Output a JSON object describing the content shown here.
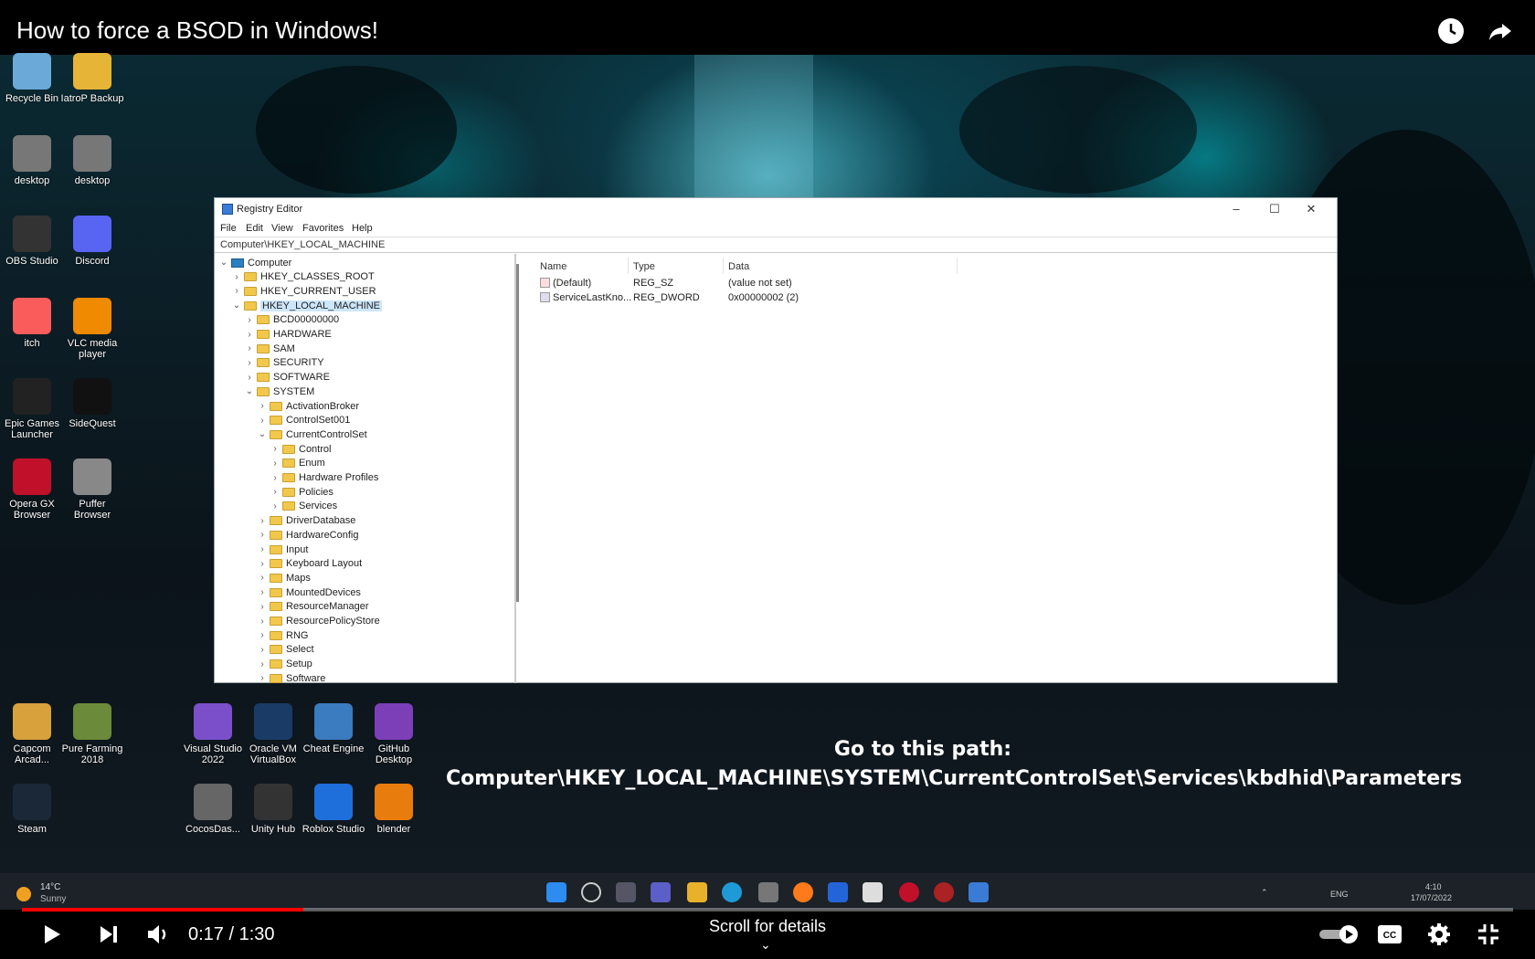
{
  "player": {
    "title": "How to force a BSOD in Windows!",
    "time": "0:17 / 1:30",
    "progress": 0.189,
    "scroll_hint": "Scroll for details",
    "autoplay_on": true
  },
  "desktop_icons": [
    {
      "label": "Recycle Bin",
      "icon": "recycle-bin-icon"
    },
    {
      "label": "IatroP Backup",
      "icon": "folder-icon"
    },
    {
      "label": "desktop",
      "icon": "shortcut-icon"
    },
    {
      "label": "desktop",
      "icon": "shortcut-icon"
    },
    {
      "label": "OBS Studio",
      "icon": "obs-icon"
    },
    {
      "label": "Discord",
      "icon": "discord-icon"
    },
    {
      "label": "itch",
      "icon": "itch-icon"
    },
    {
      "label": "VLC media player",
      "icon": "vlc-icon"
    },
    {
      "label": "Epic Games Launcher",
      "icon": "epic-icon"
    },
    {
      "label": "SideQuest",
      "icon": "sidequest-icon"
    },
    {
      "label": "Opera GX Browser",
      "icon": "opera-icon"
    },
    {
      "label": "Puffer Browser",
      "icon": "puffer-icon"
    },
    {
      "label": "Capcom Arcad...",
      "icon": "capcom-icon"
    },
    {
      "label": "Pure Farming 2018",
      "icon": "pure-farming-icon"
    },
    {
      "label": "Visual Studio 2022",
      "icon": "visual-studio-icon"
    },
    {
      "label": "Oracle VM VirtualBox",
      "icon": "virtualbox-icon"
    },
    {
      "label": "Cheat Engine",
      "icon": "cheat-engine-icon"
    },
    {
      "label": "GitHub Desktop",
      "icon": "github-icon"
    },
    {
      "label": "Steam",
      "icon": "steam-icon"
    },
    {
      "label": "CocosDas...",
      "icon": "cocos-icon"
    },
    {
      "label": "Unity Hub",
      "icon": "unity-icon"
    },
    {
      "label": "Roblox Studio",
      "icon": "roblox-icon"
    },
    {
      "label": "blender",
      "icon": "blender-icon"
    }
  ],
  "regedit": {
    "title": "Registry Editor",
    "menu": [
      "File",
      "Edit",
      "View",
      "Favorites",
      "Help"
    ],
    "address": "Computer\\HKEY_LOCAL_MACHINE",
    "tree": [
      {
        "label": "Computer",
        "depth": 0,
        "expanded": true,
        "root": true
      },
      {
        "label": "HKEY_CLASSES_ROOT",
        "depth": 1
      },
      {
        "label": "HKEY_CURRENT_USER",
        "depth": 1
      },
      {
        "label": "HKEY_LOCAL_MACHINE",
        "depth": 1,
        "expanded": true,
        "selected": true
      },
      {
        "label": "BCD00000000",
        "depth": 2
      },
      {
        "label": "HARDWARE",
        "depth": 2
      },
      {
        "label": "SAM",
        "depth": 2
      },
      {
        "label": "SECURITY",
        "depth": 2
      },
      {
        "label": "SOFTWARE",
        "depth": 2
      },
      {
        "label": "SYSTEM",
        "depth": 2,
        "expanded": true
      },
      {
        "label": "ActivationBroker",
        "depth": 3
      },
      {
        "label": "ControlSet001",
        "depth": 3
      },
      {
        "label": "CurrentControlSet",
        "depth": 3,
        "expanded": true
      },
      {
        "label": "Control",
        "depth": 4
      },
      {
        "label": "Enum",
        "depth": 4
      },
      {
        "label": "Hardware Profiles",
        "depth": 4
      },
      {
        "label": "Policies",
        "depth": 4
      },
      {
        "label": "Services",
        "depth": 4
      },
      {
        "label": "DriverDatabase",
        "depth": 3
      },
      {
        "label": "HardwareConfig",
        "depth": 3
      },
      {
        "label": "Input",
        "depth": 3
      },
      {
        "label": "Keyboard Layout",
        "depth": 3
      },
      {
        "label": "Maps",
        "depth": 3
      },
      {
        "label": "MountedDevices",
        "depth": 3
      },
      {
        "label": "ResourceManager",
        "depth": 3
      },
      {
        "label": "ResourcePolicyStore",
        "depth": 3
      },
      {
        "label": "RNG",
        "depth": 3
      },
      {
        "label": "Select",
        "depth": 3
      },
      {
        "label": "Setup",
        "depth": 3
      },
      {
        "label": "Software",
        "depth": 3
      }
    ],
    "columns": [
      "Name",
      "Type",
      "Data"
    ],
    "values": [
      {
        "name": "(Default)",
        "type": "REG_SZ",
        "data": "(value not set)"
      },
      {
        "name": "ServiceLastKno...",
        "type": "REG_DWORD",
        "data": "0x00000002 (2)"
      }
    ]
  },
  "caption": {
    "line1": "Go to this path:",
    "line2": "Computer\\HKEY_LOCAL_MACHINE\\SYSTEM\\CurrentControlSet\\Services\\kbdhid\\Parameters"
  },
  "taskbar": {
    "temp": "14°C",
    "condition": "Sunny",
    "lang": "ENG",
    "clock_time": "4:10",
    "clock_date": "17/07/2022"
  },
  "colors": {
    "progress": "#ff0000",
    "accent": "#3a7bd5"
  }
}
